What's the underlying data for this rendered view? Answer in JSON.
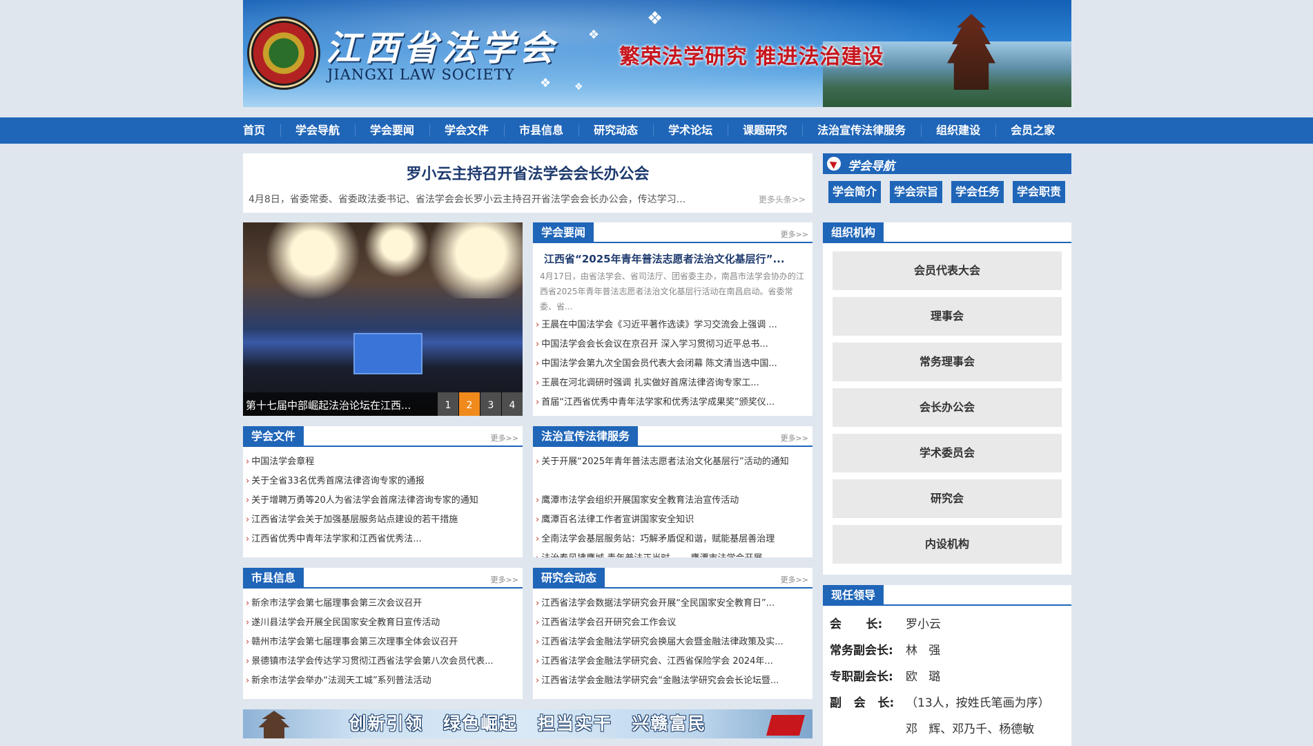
{
  "banner": {
    "title_cn": "江西省法学会",
    "title_en": "JIANGXI LAW SOCIETY",
    "slogan": "繁荣法学研究  推进法治建设"
  },
  "nav": [
    "首页",
    "学会导航",
    "学会要闻",
    "学会文件",
    "市县信息",
    "研究动态",
    "学术论坛",
    "课题研究",
    "法治宣传法律服务",
    "组织建设",
    "会员之家"
  ],
  "headline": {
    "title": "罗小云主持召开省法学会会长办公会",
    "summary": "4月8日，省委常委、省委政法委书记、省法学会会长罗小云主持召开省法学会会长办公会，传达学习...",
    "more": "更多头条>>"
  },
  "slider": {
    "caption": "第十七届中部崛起法治论坛在江西...",
    "pages": [
      "1",
      "2",
      "3",
      "4"
    ],
    "active_page": "2"
  },
  "news": {
    "tab": "学会要闻",
    "more": "更多>>",
    "lead_title": "江西省“2025年青年普法志愿者法治文化基层行”...",
    "lead_text": "4月17日，由省法学会、省司法厅、团省委主办，南昌市法学会协办的江西省2025年青年普法志愿者法治文化基层行活动在南昌启动。省委常委、省...",
    "items": [
      "王晨在中国法学会《习近平著作选读》学习交流会上强调 ...",
      "中国法学会会长会议在京召开 深入学习贯彻习近平总书...",
      "中国法学会第九次全国会员代表大会闭幕 陈文清当选中国...",
      "王晨在河北调研时强调 扎实做好首席法律咨询专家工...",
      "首届“江西省优秀中青年法学家和优秀法学成果奖”颁奖仪..."
    ]
  },
  "docs": {
    "tab": "学会文件",
    "more": "更多>>",
    "items": [
      "中国法学会章程",
      "关于全省33名优秀首席法律咨询专家的通报",
      "关于增聘万勇等20人为省法学会首席法律咨询专家的通知",
      "江西省法学会关于加强基层服务站点建设的若干措施",
      "江西省优秀中青年法学家和江西省优秀法..."
    ]
  },
  "law": {
    "tab": "法治宣传法律服务",
    "more": "更多>>",
    "items": [
      "关于开展“2025年青年普法志愿者法治文化基层行”活动的通知",
      "鹰潭市法学会组织开展国家安全教育法治宣传活动",
      "鹰潭百名法律工作者宣讲国家安全知识",
      "全南法学会基层服务站：巧解矛盾促和谐，赋能基层善治理",
      "法治春风拂鹰城 青年普法正当时 ——鹰潭市法学会开展..."
    ]
  },
  "city": {
    "tab": "市县信息",
    "more": "更多>>",
    "items": [
      "新余市法学会第七届理事会第三次会议召开",
      "遂川县法学会开展全民国家安全教育日宣传活动",
      "赣州市法学会第七届理事会第三次理事全体会议召开",
      "景德镇市法学会传达学习贯彻江西省法学会第八次会员代表...",
      "新余市法学会举办“法润天工城”系列普法活动"
    ]
  },
  "research": {
    "tab": "研究会动态",
    "more": "更多>>",
    "items": [
      "江西省法学会数据法学研究会开展“全民国家安全教育日”...",
      "江西省法学会召开研究会工作会议",
      "江西省法学会金融法学研究会换届大会暨金融法律政策及实...",
      "江西省法学会金融法学研究会、江西省保险学会 2024年...",
      "江西省法学会金融法学研究会“金融法学研究会会长论坛暨..."
    ]
  },
  "bottom_banner": {
    "slogan": "创新引领 绿色崛起 担当实干 兴赣富民"
  },
  "society_nav": {
    "title": "学会导航",
    "buttons": [
      "学会简介",
      "学会宗旨",
      "学会任务",
      "学会职责"
    ]
  },
  "org": {
    "tab": "组织机构",
    "buttons": [
      "会员代表大会",
      "理事会",
      "常务理事会",
      "会长办公会",
      "学术委员会",
      "研究会",
      "内设机构"
    ]
  },
  "leaders": {
    "tab": "现任领导",
    "rows": [
      {
        "k": "会      长:",
        "v": "罗小云"
      },
      {
        "k": "常务副会长:",
        "v": "林   强"
      },
      {
        "k": "专职副会长:",
        "v": "欧   璐"
      },
      {
        "k": "副   会   长:",
        "v": "（13人，按姓氏笔画为序）"
      }
    ],
    "continuation": "邓   辉、邓乃千、杨德敏"
  },
  "colors": {
    "nav_blue": "#1f65b8",
    "accent_orange": "#f08a1c",
    "slogan_red": "#c8161d",
    "background": "#dfe6ee"
  }
}
